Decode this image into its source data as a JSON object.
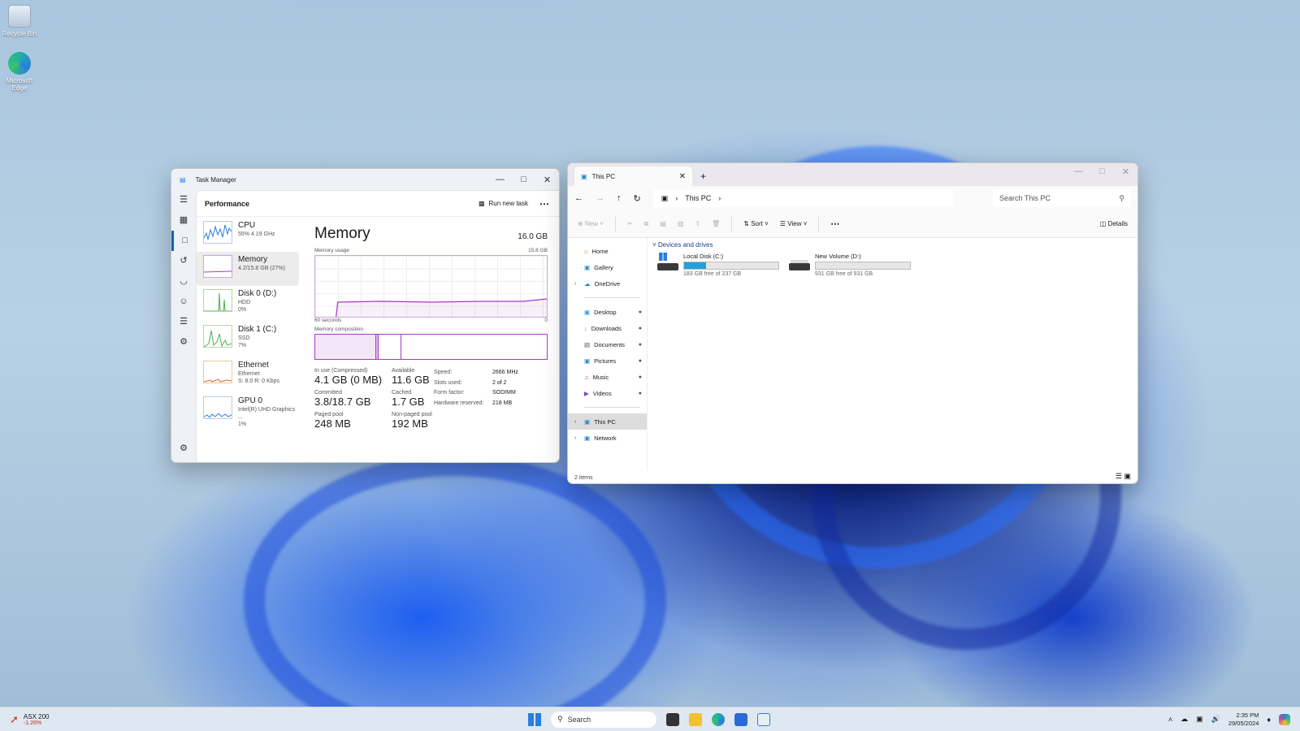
{
  "desktop": {
    "icons": [
      {
        "label": "Recycle Bin"
      },
      {
        "label": "Microsoft Edge"
      }
    ]
  },
  "task_manager": {
    "title": "Task Manager",
    "section": "Performance",
    "run_new_task": "Run new task",
    "devices": [
      {
        "name": "CPU",
        "sub1": "55% 4.19 GHz",
        "sub2": ""
      },
      {
        "name": "Memory",
        "sub1": "4.2/15.8 GB (27%)",
        "sub2": ""
      },
      {
        "name": "Disk 0 (D:)",
        "sub1": "HDD",
        "sub2": "0%"
      },
      {
        "name": "Disk 1 (C:)",
        "sub1": "SSD",
        "sub2": "7%"
      },
      {
        "name": "Ethernet",
        "sub1": "Ethernet",
        "sub2": "S: 8.0 R: 0 Kbps"
      },
      {
        "name": "GPU 0",
        "sub1": "Intel(R) UHD Graphics ...",
        "sub2": "1%"
      }
    ],
    "memory": {
      "heading": "Memory",
      "total": "16.0 GB",
      "usage_label": "Memory usage",
      "usage_max": "15.8 GB",
      "axis_left": "60 seconds",
      "axis_right": "0",
      "composition_label": "Memory composition",
      "in_use_label": "In use (Compressed)",
      "in_use": "4.1 GB (0 MB)",
      "available_label": "Available",
      "available": "11.6 GB",
      "committed_label": "Committed",
      "committed": "3.8/18.7 GB",
      "cached_label": "Cached",
      "cached": "1.7 GB",
      "paged_label": "Paged pool",
      "paged": "248 MB",
      "nonpaged_label": "Non-paged pool",
      "nonpaged": "192 MB",
      "specs": [
        {
          "k": "Speed:",
          "v": "2666 MHz"
        },
        {
          "k": "Slots used:",
          "v": "2 of 2"
        },
        {
          "k": "Form factor:",
          "v": "SODIMM"
        },
        {
          "k": "Hardware reserved:",
          "v": "218 MB"
        }
      ]
    }
  },
  "explorer": {
    "tab_title": "This PC",
    "breadcrumb": "This PC",
    "search_placeholder": "Search This PC",
    "cmd": {
      "new": "New",
      "sort": "Sort",
      "view": "View",
      "details": "Details"
    },
    "nav": [
      {
        "label": "Home"
      },
      {
        "label": "Gallery"
      },
      {
        "label": "OneDrive"
      },
      {
        "label": "Desktop"
      },
      {
        "label": "Downloads"
      },
      {
        "label": "Documents"
      },
      {
        "label": "Pictures"
      },
      {
        "label": "Music"
      },
      {
        "label": "Videos"
      },
      {
        "label": "This PC"
      },
      {
        "label": "Network"
      }
    ],
    "group_title": "Devices and drives",
    "drives": [
      {
        "name": "Local Disk (C:)",
        "free": "183 GB free of 237 GB",
        "used_fraction": 0.23
      },
      {
        "name": "New Volume (D:)",
        "free": "931 GB free of 931 GB",
        "used_fraction": 0.0
      }
    ],
    "status": "2 items"
  },
  "taskbar": {
    "widget_name": "ASX 200",
    "widget_change": "-1.26%",
    "search": "Search",
    "time": "2:35 PM",
    "date": "29/05/2024"
  },
  "colors": {
    "accent": "#0067c0",
    "memory": "#a43bc7",
    "drive_fill": "#26a0da"
  }
}
